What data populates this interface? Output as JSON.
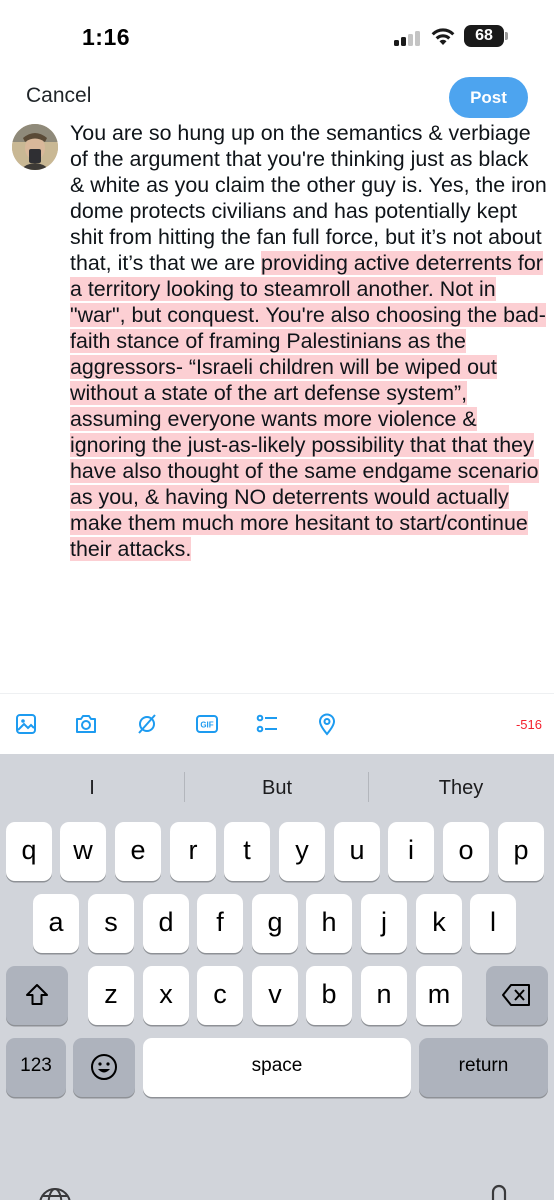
{
  "status_bar": {
    "time": "1:16",
    "battery": "68",
    "icons": [
      "cellular-signal-icon",
      "wifi-icon",
      "battery-icon"
    ]
  },
  "header": {
    "cancel_label": "Cancel",
    "post_label": "Post",
    "post_color": "#4da4ef"
  },
  "compose": {
    "text_plain": "You are so hung up on the semantics & verbiage of the argument that you're thinking just as black & white as you claim the other guy is. Yes, the iron dome protects civilians and has potentially kept shit from hitting the fan full force, but it’s not about that, it’s that we are ",
    "text_highlighted": "providing active deterrents for a territory looking to steamroll another. Not in \"war\", but conquest. You're also choosing the bad-faith stance of framing Palestinians as the aggressors- “Israeli children will be wiped out without a state of the art defense system”, assuming everyone wants more violence & ignoring the just-as-likely possibility that that they have also thought of the same endgame scenario as you, & having NO deterrents would actually make them much more hesitant to start/continue their attacks.",
    "highlight_color": "#fccfd3"
  },
  "toolbar": {
    "icons": [
      "image-icon",
      "camera-icon",
      "grok-icon",
      "gif-icon",
      "poll-icon",
      "location-icon"
    ],
    "char_count": "-516",
    "char_count_color": "#f4212e",
    "icon_color": "#1d9bf0"
  },
  "keyboard": {
    "suggestions": [
      "I",
      "But",
      "They"
    ],
    "row1": [
      "q",
      "w",
      "e",
      "r",
      "t",
      "y",
      "u",
      "i",
      "o",
      "p"
    ],
    "row2": [
      "a",
      "s",
      "d",
      "f",
      "g",
      "h",
      "j",
      "k",
      "l"
    ],
    "row3": [
      "z",
      "x",
      "c",
      "v",
      "b",
      "n",
      "m"
    ],
    "numbers_label": "123",
    "space_label": "space",
    "return_label": "return"
  }
}
